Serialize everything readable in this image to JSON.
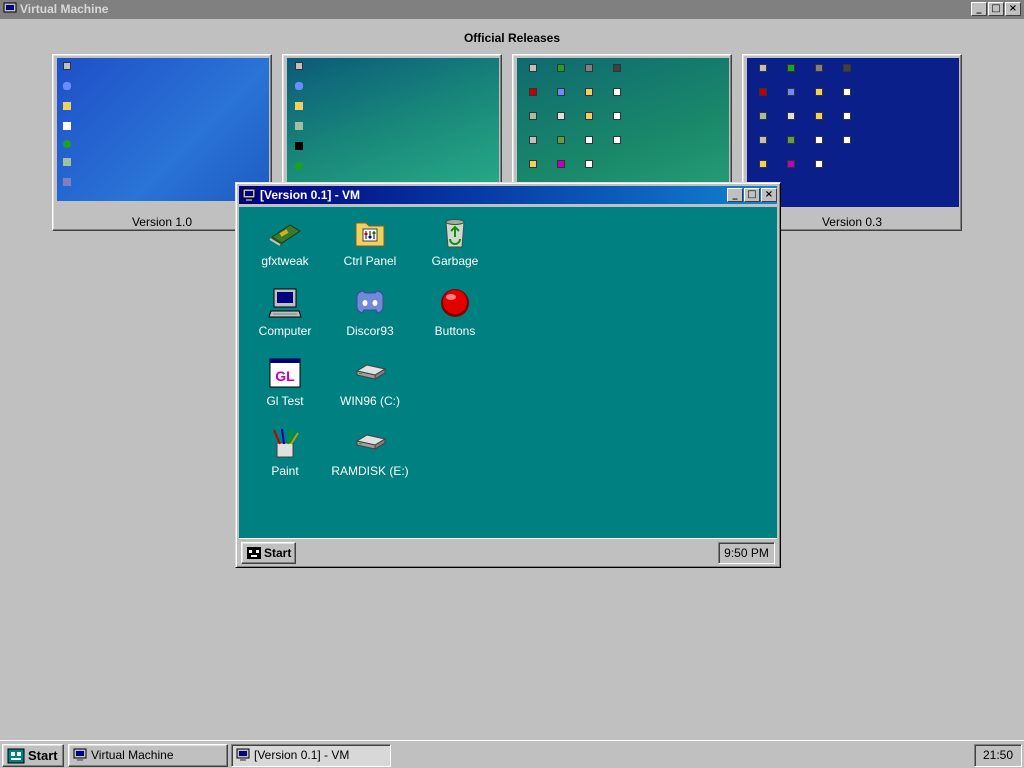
{
  "host": {
    "window_title": "Virtual Machine",
    "releases_title": "Official Releases",
    "title_buttons": {
      "minimize": "_",
      "maximize": "□",
      "close": "×"
    }
  },
  "thumbnails": [
    {
      "caption": "Version 1.0"
    },
    {
      "caption": ""
    },
    {
      "caption": ""
    },
    {
      "caption": "Version 0.3"
    }
  ],
  "vm": {
    "window_title": "[Version 0.1] - VM",
    "title_buttons": {
      "minimize": "_",
      "maximize": "□",
      "close": "×"
    },
    "desktop_icons": [
      {
        "label": "gfxtweak",
        "icon": "gfx-card-icon"
      },
      {
        "label": "Ctrl Panel",
        "icon": "control-panel-folder-icon"
      },
      {
        "label": "Garbage",
        "icon": "recycle-bin-icon"
      },
      {
        "label": "Computer",
        "icon": "computer-icon"
      },
      {
        "label": "Discor93",
        "icon": "discord-icon"
      },
      {
        "label": "Buttons",
        "icon": "red-button-icon"
      },
      {
        "label": "Gl Test",
        "icon": "gl-window-icon"
      },
      {
        "label": "WIN96 (C:)",
        "icon": "hard-drive-icon"
      },
      {
        "label": "Paint",
        "icon": "paint-brushes-icon"
      },
      {
        "label": "RAMDISK (E:)",
        "icon": "ramdisk-drive-icon"
      }
    ],
    "start_label": "Start",
    "clock": "9:50 PM"
  },
  "taskbar": {
    "start_label": "Start",
    "tasks": [
      {
        "label": "Virtual Machine"
      },
      {
        "label": "[Version 0.1] - VM"
      }
    ],
    "clock": "21:50"
  },
  "colors": {
    "vm_desktop": "#008080",
    "vm_title_start": "#000080",
    "vm_title_end": "#1084d0",
    "face": "#c0c0c0"
  }
}
